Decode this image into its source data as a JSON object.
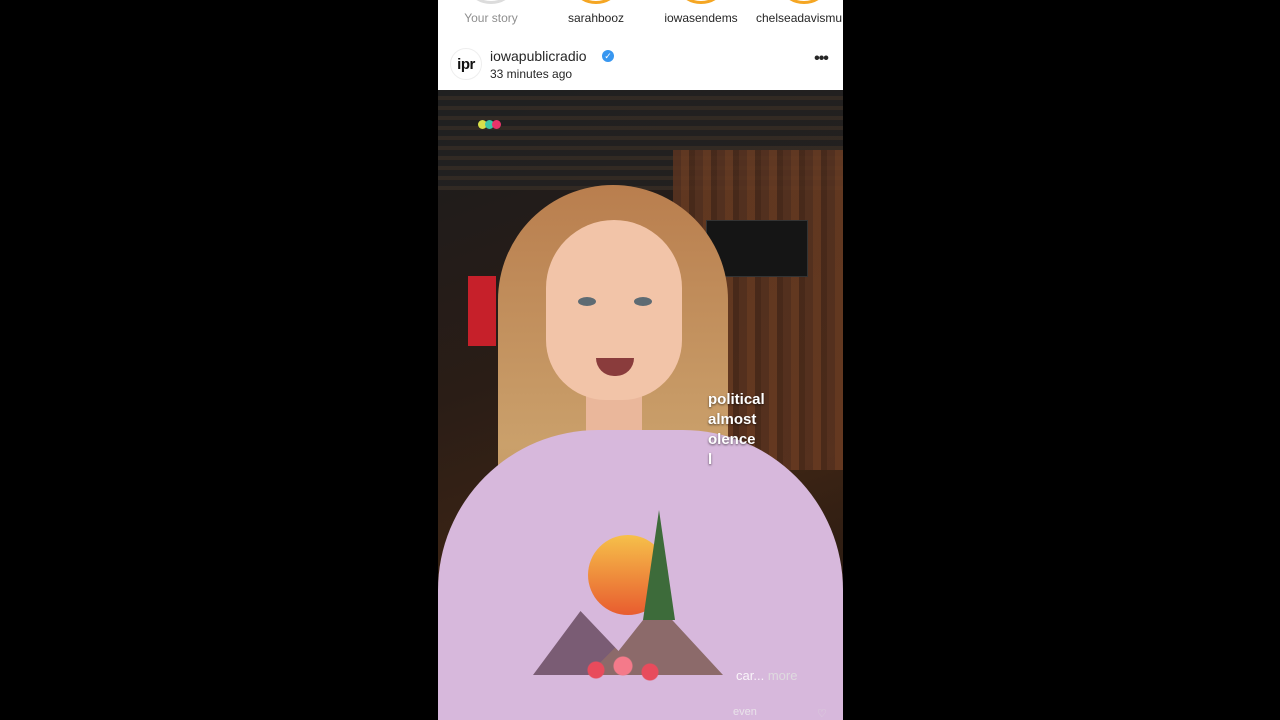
{
  "stories": [
    {
      "label": "Your story"
    },
    {
      "label": "sarahbooz"
    },
    {
      "label": "iowasendems"
    },
    {
      "label": "chelseadavismu"
    }
  ],
  "post": {
    "avatar_text": "ipr",
    "username": "iowapublicradio",
    "verified_mark": "✓",
    "timestamp": "33 minutes ago",
    "more_icon": "•••"
  },
  "video": {
    "caption_lines": [
      "political",
      "almost",
      "olence",
      "l"
    ],
    "more_prefix": "car...",
    "more_label": "more",
    "bottom_text": "even"
  },
  "colors": {
    "verified": "#3897f0",
    "story_ring": "#f5a623"
  }
}
